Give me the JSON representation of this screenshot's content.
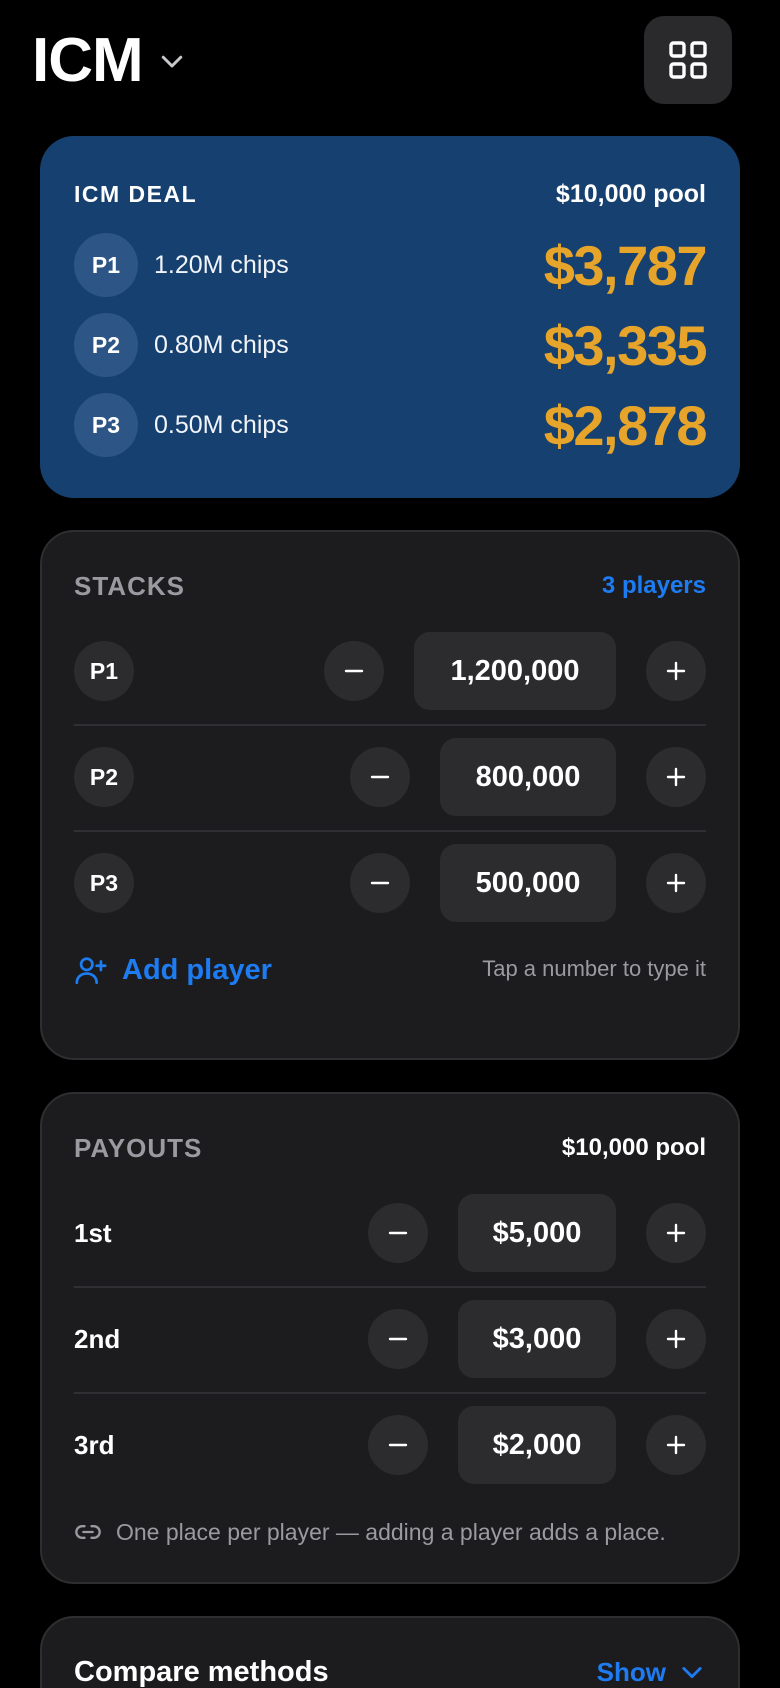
{
  "header": {
    "title": "ICM",
    "menu_icon": "chevron-down-icon",
    "grid_icon": "grid-icon"
  },
  "deal": {
    "label": "ICM DEAL",
    "pool": "$10,000 pool",
    "rows": [
      {
        "badge": "P1",
        "chips": "1.20M chips",
        "amount": "$3,787"
      },
      {
        "badge": "P2",
        "chips": "0.80M chips",
        "amount": "$3,335"
      },
      {
        "badge": "P3",
        "chips": "0.50M chips",
        "amount": "$2,878"
      }
    ]
  },
  "stacks": {
    "title": "STACKS",
    "count": "3 players",
    "rows": [
      {
        "badge": "P1",
        "value": "1,200,000"
      },
      {
        "badge": "P2",
        "value": "800,000"
      },
      {
        "badge": "P3",
        "value": "500,000"
      }
    ],
    "add_label": "Add player",
    "hint": "Tap a number to type it"
  },
  "payouts": {
    "title": "PAYOUTS",
    "pool": "$10,000 pool",
    "rows": [
      {
        "place": "1st",
        "value": "$5,000"
      },
      {
        "place": "2nd",
        "value": "$3,000"
      },
      {
        "place": "3rd",
        "value": "$2,000"
      }
    ],
    "note": "One place per player — adding a player adds a place."
  },
  "compare": {
    "title": "Compare methods",
    "toggle_label": "Show"
  },
  "colors": {
    "accent_blue": "#1e7cf2",
    "gold": "#e6a52a",
    "deal_card_bg": "#16406f"
  }
}
